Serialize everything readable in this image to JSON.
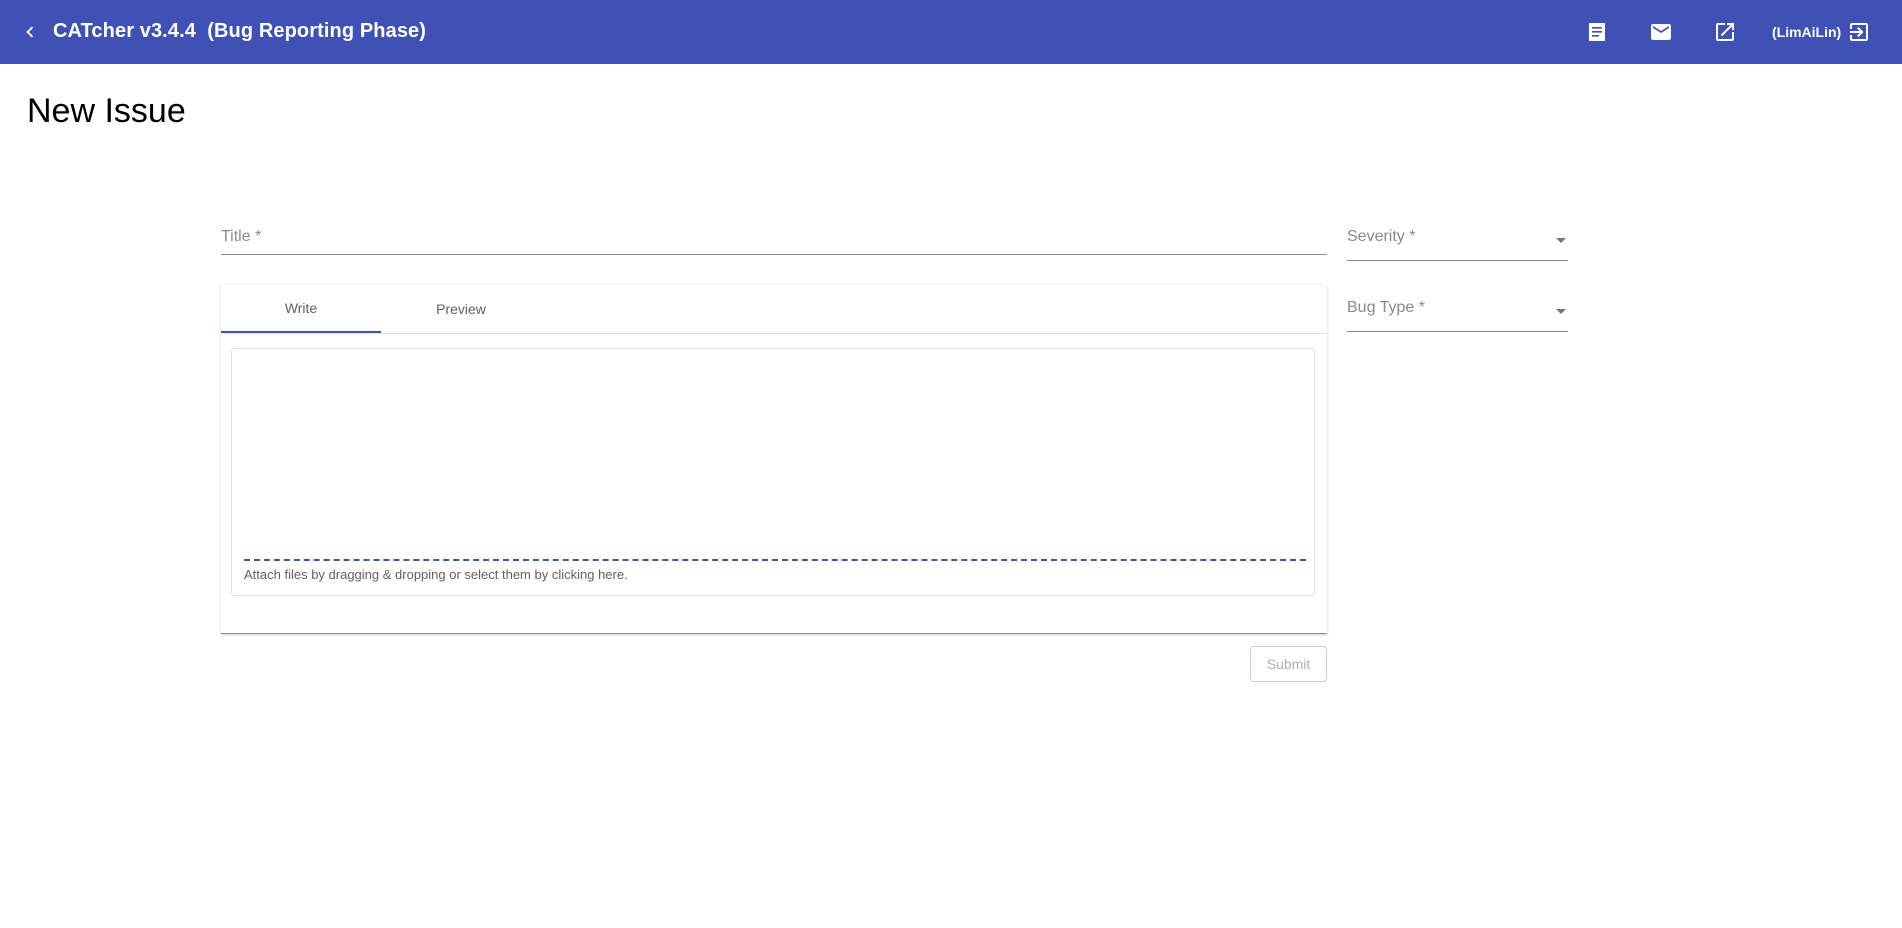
{
  "header": {
    "title": "CATcher v3.4.4  (Bug Reporting Phase)",
    "user": "(LimAiLin)",
    "icons": [
      "back-arrow-icon",
      "document-icon",
      "mail-icon",
      "open-in-new-icon",
      "logout-icon"
    ]
  },
  "page": {
    "title": "New Issue"
  },
  "form": {
    "title_label": "Title *",
    "severity_label": "Severity *",
    "bug_type_label": "Bug Type *",
    "tabs": [
      {
        "label": "Write",
        "active": true
      },
      {
        "label": "Preview",
        "active": false
      }
    ],
    "attach_hint": "Attach files by dragging & dropping or select them by clicking here.",
    "submit_label": "Submit"
  },
  "colors": {
    "primary": "#3f51b5",
    "background": "#ffffff"
  }
}
